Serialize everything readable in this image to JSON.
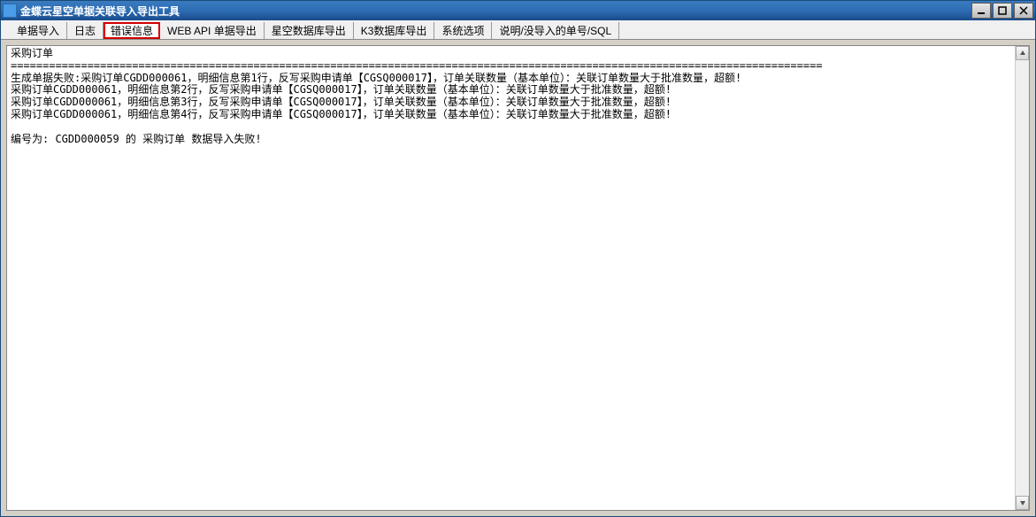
{
  "window": {
    "title": "金蝶云星空单据关联导入导出工具"
  },
  "tabs": {
    "t0": "单据导入",
    "t1": "日志",
    "t2": "错误信息",
    "t3": "WEB API 单据导出",
    "t4": "星空数据库导出",
    "t5": "K3数据库导出",
    "t6": "系统选项",
    "t7": "说明/没导入的单号/SQL"
  },
  "content": {
    "line0": "采购订单",
    "line1": "===============================================================================================================================",
    "line2": "生成单据失败:采购订单CGDD000061，明细信息第1行，反写采购申请单【CGSQ000017】，订单关联数量（基本单位）：关联订单数量大于批准数量，超额!",
    "line3": "采购订单CGDD000061，明细信息第2行，反写采购申请单【CGSQ000017】，订单关联数量（基本单位）：关联订单数量大于批准数量，超额!",
    "line4": "采购订单CGDD000061，明细信息第3行，反写采购申请单【CGSQ000017】，订单关联数量（基本单位）：关联订单数量大于批准数量，超额!",
    "line5": "采购订单CGDD000061，明细信息第4行，反写采购申请单【CGSQ000017】，订单关联数量（基本单位）：关联订单数量大于批准数量，超额!",
    "line6": "",
    "line7": "编号为: CGDD000059 的 采购订单 数据导入失败!"
  }
}
